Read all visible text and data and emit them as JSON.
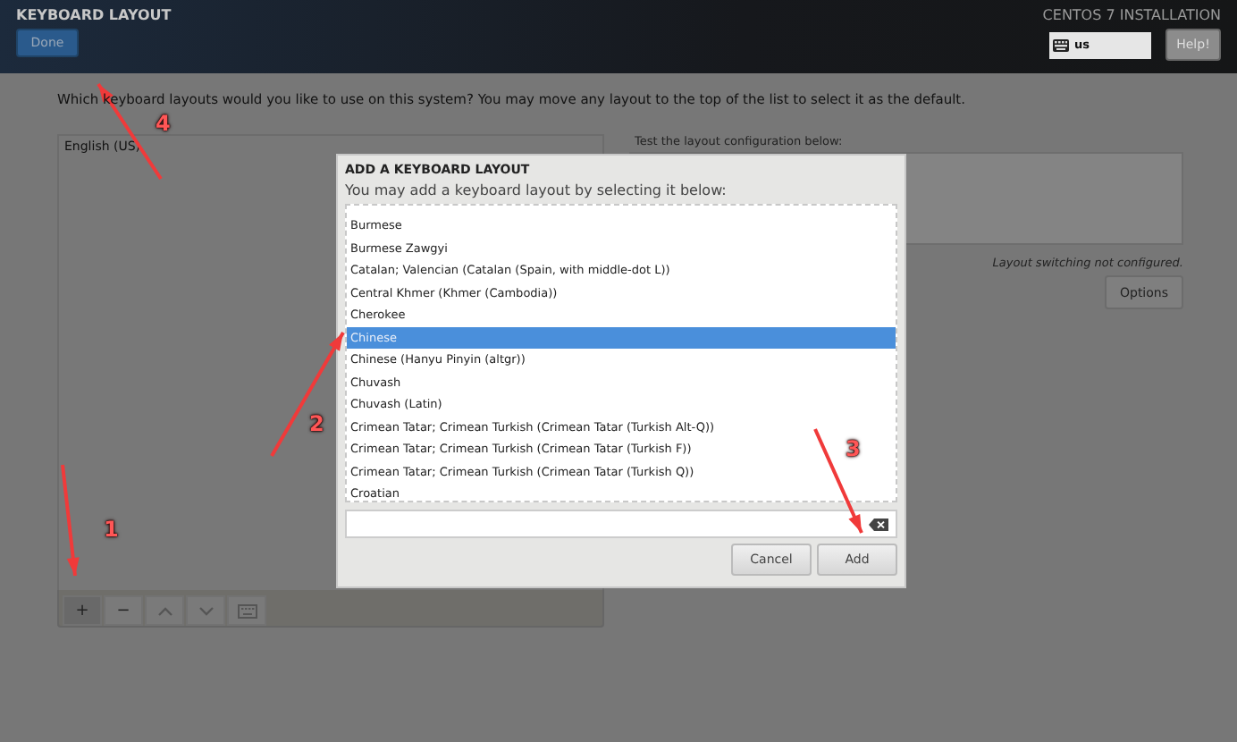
{
  "header": {
    "title": "KEYBOARD LAYOUT",
    "done_button": "Done",
    "product": "CENTOS 7 INSTALLATION",
    "keyboard_indicator": "us",
    "help_button": "Help!"
  },
  "question": "Which keyboard layouts would you like to use on this system?  You may move any layout to the top of the list to select it as the default.",
  "layouts": [
    {
      "label": "English (US)",
      "selected": false
    }
  ],
  "toolbar": [
    {
      "kind": "text",
      "label": "+"
    },
    {
      "kind": "text",
      "label": "−"
    },
    {
      "kind": "up"
    },
    {
      "kind": "down"
    },
    {
      "kind": "keyboard"
    }
  ],
  "test_label": "Test the layout configuration below:",
  "switching_note": "Layout switching not configured.",
  "options_button": "Options",
  "dialog": {
    "title": "ADD A KEYBOARD LAYOUT",
    "subtitle": "You may add a keyboard layout by selecting it below:",
    "items": [
      {
        "label": "Burmese",
        "selected": false
      },
      {
        "label": "Burmese Zawgyi",
        "selected": false
      },
      {
        "label": "Catalan; Valencian (Catalan (Spain, with middle-dot L))",
        "selected": false
      },
      {
        "label": "Central Khmer (Khmer (Cambodia))",
        "selected": false
      },
      {
        "label": "Cherokee",
        "selected": false
      },
      {
        "label": "Chinese",
        "selected": true
      },
      {
        "label": "Chinese (Hanyu Pinyin (altgr))",
        "selected": false
      },
      {
        "label": "Chuvash",
        "selected": false
      },
      {
        "label": "Chuvash (Latin)",
        "selected": false
      },
      {
        "label": "Crimean Tatar; Crimean Turkish (Crimean Tatar (Turkish Alt-Q))",
        "selected": false
      },
      {
        "label": "Crimean Tatar; Crimean Turkish (Crimean Tatar (Turkish F))",
        "selected": false
      },
      {
        "label": "Crimean Tatar; Crimean Turkish (Crimean Tatar (Turkish Q))",
        "selected": false
      },
      {
        "label": "Croatian",
        "selected": false
      }
    ],
    "buttons": [
      "Cancel",
      "Add"
    ]
  },
  "annotations": [
    "1",
    "2",
    "3",
    "4"
  ]
}
